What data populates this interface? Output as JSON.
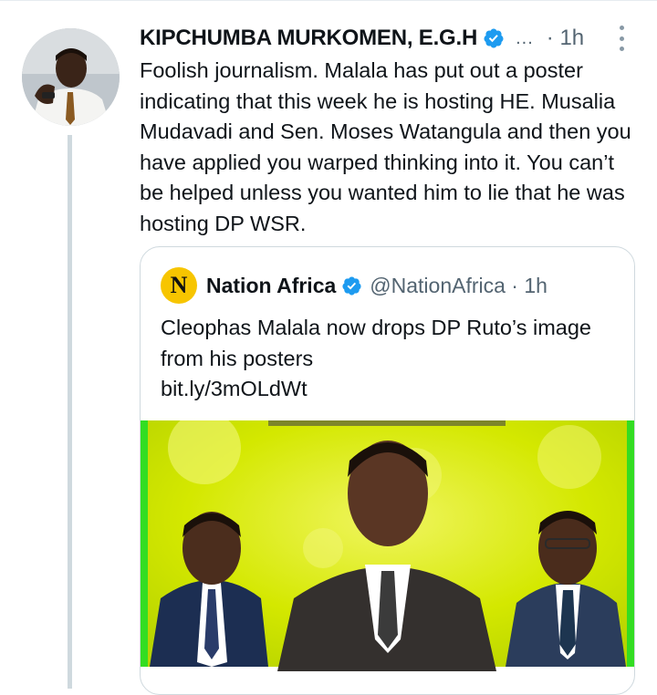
{
  "tweet": {
    "author_name": "KIPCHUMBA MURKOMEN, E.G.H",
    "verified_icon": "verified-badge-icon",
    "name_truncation": "...",
    "timestamp": "· 1h",
    "more_icon": "more-options-icon",
    "text": "Foolish journalism. Malala has put out a poster indicating that this week he is hosting HE. Musalia Mudavadi and Sen. Moses Watangula and then you have applied you warped thinking into it. You can’t be helped unless you wanted him to lie that he was hosting DP WSR."
  },
  "quoted_tweet": {
    "logo_letter": "N",
    "author_name": "Nation Africa",
    "handle_time": "@NationAfrica · 1h",
    "text": "Cleophas Malala now drops DP Ruto’s image from his posters",
    "link": "bit.ly/3mOLdWt",
    "image_description": "poster-image"
  },
  "colors": {
    "text": "#0f1419",
    "muted": "#536471",
    "verified_blue": "#1d9bf0",
    "border": "#cfd9de",
    "poster_green": "#33dd22",
    "poster_yellow": "#d4e800"
  }
}
